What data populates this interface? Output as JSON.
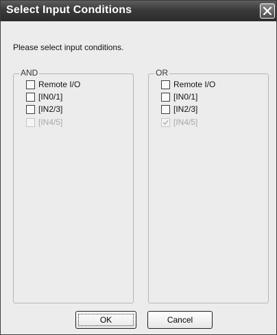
{
  "dialog": {
    "title": "Select Input Conditions",
    "prompt": "Please select input conditions."
  },
  "groups": {
    "and": {
      "legend": "AND",
      "options": [
        {
          "label": "Remote I/O",
          "checked": false,
          "enabled": true
        },
        {
          "label": "[IN0/1]",
          "checked": false,
          "enabled": true
        },
        {
          "label": "[IN2/3]",
          "checked": false,
          "enabled": true
        },
        {
          "label": "[IN4/5]",
          "checked": false,
          "enabled": false
        }
      ]
    },
    "or": {
      "legend": "OR",
      "options": [
        {
          "label": "Remote I/O",
          "checked": false,
          "enabled": true
        },
        {
          "label": "[IN0/1]",
          "checked": false,
          "enabled": true
        },
        {
          "label": "[IN2/3]",
          "checked": false,
          "enabled": true
        },
        {
          "label": "[IN4/5]",
          "checked": true,
          "enabled": false
        }
      ]
    }
  },
  "buttons": {
    "ok": "OK",
    "cancel": "Cancel"
  },
  "icons": {
    "close": "close-icon",
    "check": "checkmark-icon"
  },
  "colors": {
    "titlebar": "#3a3a3a",
    "dialog_background": "#ececec",
    "disabled_text": "#a8a8a8"
  }
}
